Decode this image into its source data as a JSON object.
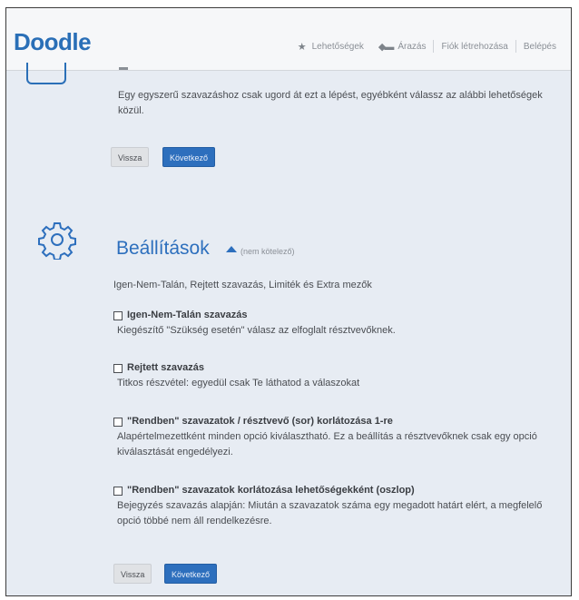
{
  "header": {
    "logo": "Doodle",
    "nav": {
      "features": "Lehetőségek",
      "pricing": "Árazás",
      "signup": "Fiók létrehozása",
      "login": "Belépés"
    }
  },
  "intro_section": {
    "text": "Egy egyszerű szavazáshoz csak ugord át ezt a lépést, egyébként válassz az alábbi lehetőségek közül.",
    "back_label": "Vissza",
    "next_label": "Következő"
  },
  "settings": {
    "title": "Beállítások",
    "optional_label": "(nem kötelező)",
    "summary": "Igen-Nem-Talán, Rejtett szavazás, Limiték és Extra mezők",
    "options": [
      {
        "label": "Igen-Nem-Talán szavazás",
        "description": "Kiegészítő \"Szükség esetén\" válasz az elfoglalt résztvevőknek.",
        "checked": false
      },
      {
        "label": "Rejtett szavazás",
        "description": "Titkos részvétel: egyedül csak Te láthatod a válaszokat",
        "checked": false
      },
      {
        "label": "\"Rendben\" szavazatok / résztvevő (sor) korlátozása 1-re",
        "description": "Alapértelmezettként minden opció kiválasztható. Ez a beállítás a résztvevőknek csak egy opció kiválasztását engedélyezi.",
        "checked": false
      },
      {
        "label": "\"Rendben\" szavazatok korlátozása lehetőségekként (oszlop)",
        "description": "Bejegyzés szavazás alapján: Miután a szavazatok száma egy megadott határt elért, a megfelelő opció többé nem áll rendelkezésre.",
        "checked": false
      }
    ],
    "back_label": "Vissza",
    "next_label": "Következő"
  },
  "colors": {
    "brand_blue": "#2d6fbd",
    "page_background": "#e7ecf3"
  }
}
